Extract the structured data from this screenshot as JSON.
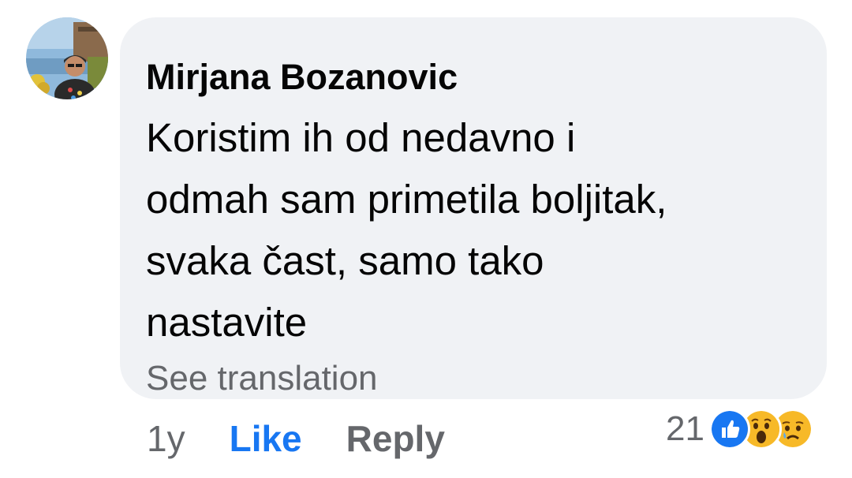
{
  "comment": {
    "author": "Mirjana Bozanovic",
    "text_lines": [
      "Koristim ih od nedavno i",
      "odmah sam primetila boljitak,",
      "svaka čast, samo tako",
      "nastavite"
    ],
    "see_translation": "See translation"
  },
  "actions": {
    "timestamp": "1y",
    "like_label": "Like",
    "reply_label": "Reply"
  },
  "reactions": {
    "count": "21",
    "icons": [
      "like-icon",
      "wow-icon",
      "sad-icon"
    ]
  },
  "colors": {
    "bubble_bg": "#f0f2f5",
    "like_blue": "#1877f2",
    "secondary_text": "#65676b",
    "primary_text": "#050505"
  }
}
